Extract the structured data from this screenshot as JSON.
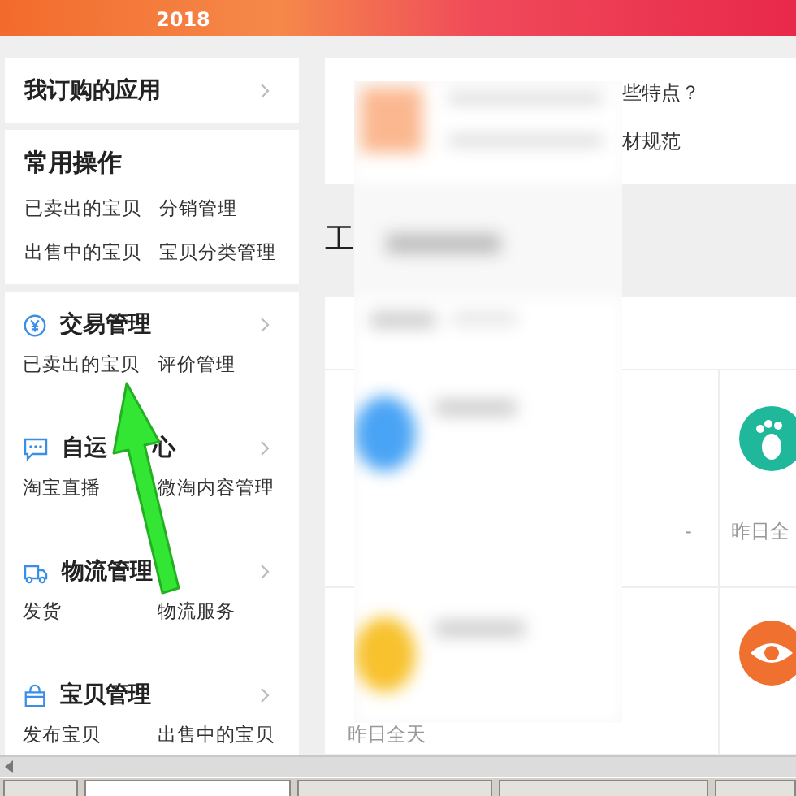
{
  "banner": {
    "year": "2018"
  },
  "sidebar": {
    "subscribed": {
      "title": "我订购的应用"
    },
    "sections": [
      {
        "title": "常用操作",
        "kind": "plain",
        "links": [
          "已卖出的宝贝",
          "分销管理",
          "出售中的宝贝",
          "宝贝分类管理"
        ]
      },
      {
        "title": "交易管理",
        "kind": "yuan",
        "links": [
          "已卖出的宝贝",
          "评价管理"
        ]
      },
      {
        "title": "自运",
        "title_end": "心",
        "kind": "chat",
        "links": [
          "淘宝直播",
          "微淘内容管理"
        ]
      },
      {
        "title": "物流管理",
        "kind": "truck",
        "links": [
          "发货",
          "物流服务"
        ]
      },
      {
        "title": "宝贝管理",
        "kind": "bag",
        "links": [
          "发布宝贝",
          "出售中的宝贝"
        ]
      }
    ]
  },
  "notice": {
    "lines": [
      "些特点？",
      "材规范"
    ]
  },
  "heading": "工",
  "stats": {
    "cells": [
      {
        "kind": "value",
        "text": "-"
      },
      {
        "kind": "footprint",
        "text": "昨日全"
      },
      {
        "kind": "caption",
        "text": "昨日全天"
      },
      {
        "kind": "eye"
      }
    ]
  }
}
